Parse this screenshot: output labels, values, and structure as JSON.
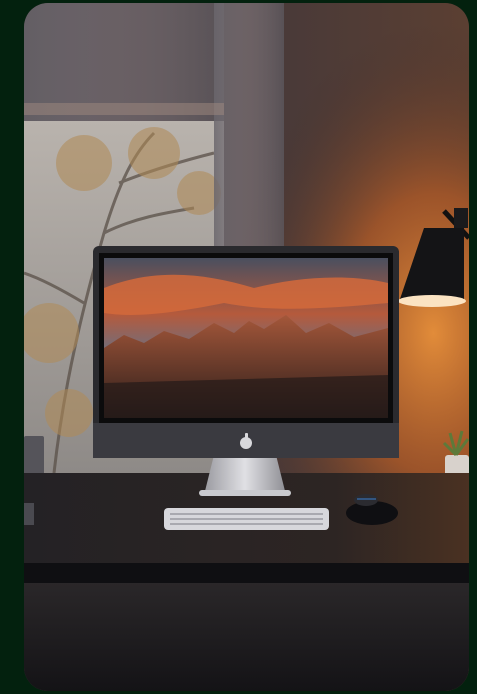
{
  "scene": {
    "subject": "desk-setup",
    "icons": {
      "apple_logo": "apple-logo-icon"
    },
    "colors": {
      "frame_bg": "#03210e",
      "wall": "#3a2e2e",
      "lamp_glow": "#d77a2c",
      "desk": "#1b1a1d",
      "sky_orange": "#d3683c",
      "sky_gray": "#5a6272"
    }
  }
}
